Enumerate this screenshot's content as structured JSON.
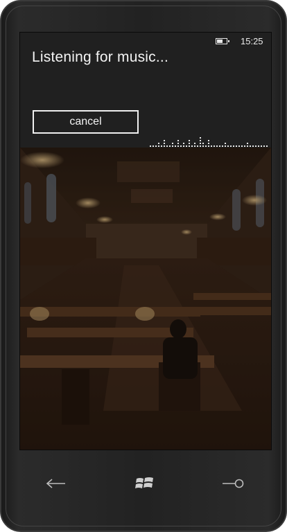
{
  "status": {
    "time": "15:25",
    "battery_icon": "battery-icon"
  },
  "screen": {
    "title": "Listening for music...",
    "cancel_label": "cancel"
  },
  "photo": {
    "copyright_symbol": "©"
  },
  "nav": {
    "back_icon": "back-arrow-icon",
    "start_icon": "windows-logo-icon",
    "search_icon": "search-icon"
  },
  "colors": {
    "screen_bg": "#202020",
    "text": "#f4f4f4",
    "phone_body": "#222222"
  }
}
